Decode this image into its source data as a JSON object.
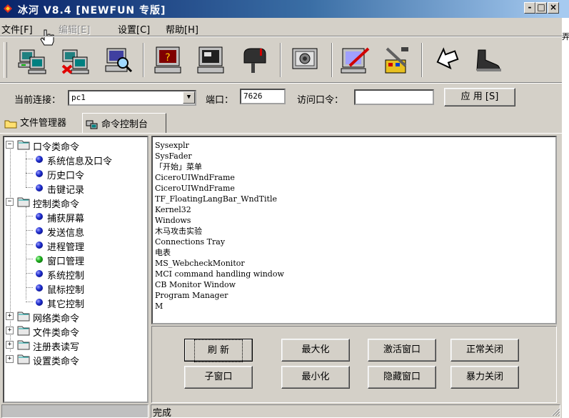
{
  "window": {
    "title": "冰河 V8.4 [NEWFUN 专版]",
    "controls": {
      "minimize": "-",
      "maximize": "□",
      "close": "×"
    }
  },
  "menu": {
    "file": "文件[F]",
    "edit": "编辑[E]",
    "settings": "设置[C]",
    "help": "帮助[H]"
  },
  "toolbar": {
    "icons": [
      "computer-icon",
      "computer-remove-icon",
      "computer-search-icon",
      "monitor-help-icon",
      "monitor-icon",
      "mailbox-icon",
      "screen-capture-icon",
      "monitor-pen-icon",
      "tools-icon",
      "arrow-icon",
      "shoe-icon"
    ]
  },
  "connection": {
    "current_label": "当前连接：",
    "current_value": "pc1",
    "port_label": "端口：",
    "port_value": "7626",
    "password_label": "访问口令：",
    "password_value": "",
    "apply_label": "应 用 [S]"
  },
  "tabs": {
    "file_manager": "文件管理器",
    "command_console": "命令控制台"
  },
  "tree": {
    "groups": [
      {
        "label": "口令类命令",
        "expanded": true,
        "children": [
          "系统信息及口令",
          "历史口令",
          "击键记录"
        ]
      },
      {
        "label": "控制类命令",
        "expanded": true,
        "children": [
          "捕获屏幕",
          "发送信息",
          "进程管理",
          "窗口管理",
          "系统控制",
          "鼠标控制",
          "其它控制"
        ]
      },
      {
        "label": "网络类命令",
        "expanded": false,
        "children": []
      },
      {
        "label": "文件类命令",
        "expanded": false,
        "children": []
      },
      {
        "label": "注册表读写",
        "expanded": false,
        "children": []
      },
      {
        "label": "设置类命令",
        "expanded": false,
        "children": []
      }
    ],
    "selected": "窗口管理"
  },
  "output_lines": [
    "Sysexplr",
    "SysFader",
    "「开始」菜单",
    "CiceroUIWndFrame",
    "CiceroUIWndFrame",
    "TF_FloatingLangBar_WndTitle",
    "Kernel32",
    "Windows",
    "木马攻击实验",
    "Connections Tray",
    "电表",
    "MS_WebcheckMonitor",
    "MCI command handling window",
    "CB Monitor Window",
    "Program Manager",
    "M"
  ],
  "buttons": {
    "refresh": "刷 新",
    "maximize": "最大化",
    "activate": "激活窗口",
    "normal_close": "正常关闭",
    "child_window": "子窗口",
    "minimize": "最小化",
    "hide": "隐藏窗口",
    "force_close": "暴力关闭"
  },
  "status": {
    "text": "完成"
  },
  "right_strip": {
    "glyph": "弄"
  }
}
